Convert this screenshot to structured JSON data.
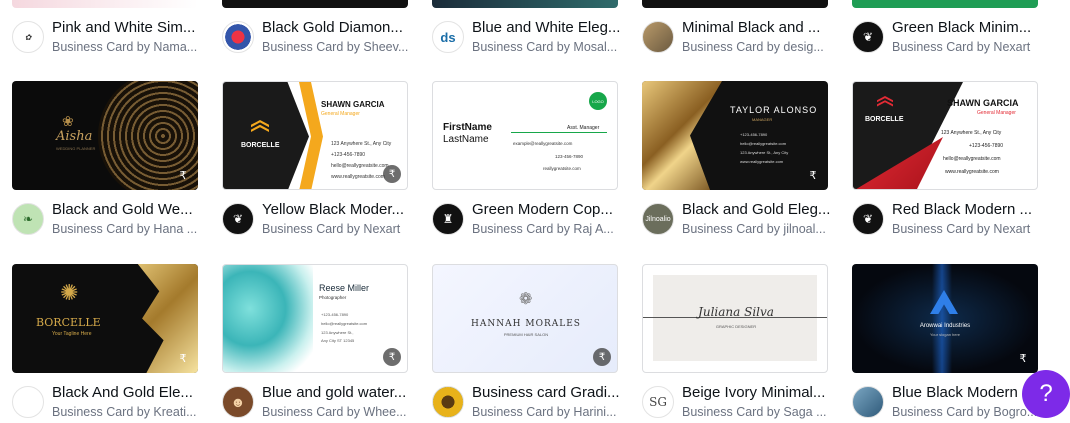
{
  "cards": [
    {
      "title": "Pink and White Sim...",
      "by": "Business Card by Nama...",
      "avatar": "icon"
    },
    {
      "title": "Black Gold Diamon...",
      "by": "Business Card by Sheev...",
      "avatar": "icon"
    },
    {
      "title": "Blue and White Eleg...",
      "by": "Business Card by Mosal...",
      "avatar": "ds"
    },
    {
      "title": "Minimal Black and ...",
      "by": "Business Card by desig...",
      "avatar": "photo"
    },
    {
      "title": "Green Black Minim...",
      "by": "Business Card by Nexart",
      "avatar": "icon"
    },
    {
      "title": "Black and Gold We...",
      "by": "Business Card by Hana ...",
      "avatar": "icon"
    },
    {
      "title": "Yellow Black Moder...",
      "by": "Business Card by Nexart",
      "avatar": "icon"
    },
    {
      "title": "Green Modern Cop...",
      "by": "Business Card by Raj A...",
      "avatar": "icon"
    },
    {
      "title": "Black and Gold Eleg...",
      "by": "Business Card by jilnoal...",
      "avatar": "Jilnoalio"
    },
    {
      "title": "Red Black Modern ...",
      "by": "Business Card by Nexart",
      "avatar": "icon"
    },
    {
      "title": "Black And Gold Ele...",
      "by": "Business Card by Kreati...",
      "avatar": "icon"
    },
    {
      "title": "Blue and gold water...",
      "by": "Business Card by Whee...",
      "avatar": "icon"
    },
    {
      "title": "Business card Gradi...",
      "by": "Business Card by Harini...",
      "avatar": "icon"
    },
    {
      "title": "Beige Ivory Minimal...",
      "by": "Business Card by Saga ...",
      "avatar": "SG"
    },
    {
      "title": "Blue Black Modern ...",
      "by": "Business Card by Bogro...",
      "avatar": "icon"
    }
  ],
  "thumbs": {
    "aisha": {
      "name": "Aisha",
      "role": "WEDDING PLANNER"
    },
    "borcelle1": {
      "logo": "BORCELLE",
      "name": "SHAWN GARCIA",
      "role": "General Manager",
      "addr": "123 Anywhere St., Any City",
      "phone": "+123-456-7890",
      "email": "hello@reallygreatsite.com",
      "web": "www.reallygreatsite.com"
    },
    "green": {
      "first": "FirstName",
      "last": "LastName",
      "role": "Asst. Manager",
      "badge": "LOGO",
      "email": "example@reallygreatsite.com",
      "phone": "123-456-7890",
      "web": "reallygreatsite.com"
    },
    "taylor": {
      "name": "TAYLOR ALONSO",
      "role": "MANAGER",
      "l1": "+123-456-7890",
      "l2": "hello@reallygreatsite.com",
      "l3": "123 Anywhere St., Any City",
      "l4": "www.reallygreatsite.com"
    },
    "borcelle2": {
      "logo": "BORCELLE",
      "name": "SHAWN GARCIA",
      "role": "General Manager",
      "addr": "123 Anywhere St., Any City",
      "phone": "+123-456-7890",
      "email": "hello@reallygreatsite.com",
      "web": "www.reallygreatsite.com"
    },
    "borcelle3": {
      "logo": "BORCELLE",
      "tag": "Your Tagline Here"
    },
    "reese": {
      "name": "Reese Miller",
      "role": "Photographer",
      "l1": "+123-456-7890",
      "l2": "hello@reallygreatsite.com",
      "l3": "123 Anywhere St.,",
      "l4": "Any City ST 12345"
    },
    "hannah": {
      "name": "HANNAH MORALES",
      "role": "PREMIUM HAIR SALON"
    },
    "juliana": {
      "name": "Juliana Silva",
      "role": "GRAPHIC DESIGNER"
    },
    "arowwai": {
      "name": "Arowwai Industries",
      "tag": "Your slogan here"
    }
  },
  "price_symbol": "₹",
  "help_label": "?"
}
